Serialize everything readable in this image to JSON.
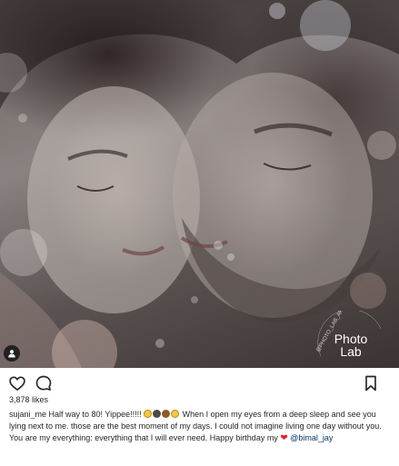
{
  "post": {
    "watermark_text": "Photo\nLab",
    "watermark_arc": "@PHOTO_LAB_APP",
    "likes": "3,878 likes",
    "caption": {
      "username": "sujani_me",
      "text_before_emoji": " Half way to 80! Yippee!!!!! ",
      "emojis": [
        "smile-with-glasses",
        "nerd-face",
        "sleepy-face",
        "grin-face"
      ],
      "text_after_emoji": " When I open my eyes from a deep sleep and see you lying next to me. those are the best moment of my days. I could not imagine living one day without you. You are my everything: everything that I will ever need. Happy birthday my ",
      "heart": "❤",
      "mention": "@bimal_jay"
    }
  },
  "icons": {
    "like": "heart-outline-icon",
    "comment": "comment-bubble-icon",
    "save": "bookmark-icon",
    "tag": "user-tag-icon"
  },
  "colors": {
    "text": "#262626",
    "mention": "#003569",
    "heart": "#ed1c24"
  }
}
